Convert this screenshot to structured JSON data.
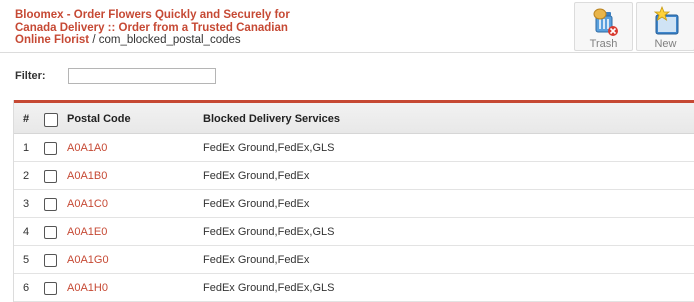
{
  "header": {
    "breadcrumb_link": "Bloomex - Order Flowers Quickly and Securely for Canada Delivery :: Order from a Trusted Canadian Online Florist",
    "breadcrumb_separator": " / ",
    "breadcrumb_current": "com_blocked_postal_codes"
  },
  "toolbar": {
    "trash_label": "Trash",
    "trash_icon": "trash-icon",
    "new_label": "New",
    "new_icon": "new-item-icon"
  },
  "filter": {
    "label": "Filter:",
    "value": "",
    "placeholder": ""
  },
  "grid": {
    "accent_color": "#c64934",
    "columns": {
      "number": "#",
      "postal_code": "Postal Code",
      "services": "Blocked Delivery Services"
    },
    "rows": [
      {
        "num": "1",
        "code": "A0A1A0",
        "services": "FedEx Ground,FedEx,GLS"
      },
      {
        "num": "2",
        "code": "A0A1B0",
        "services": "FedEx Ground,FedEx"
      },
      {
        "num": "3",
        "code": "A0A1C0",
        "services": "FedEx Ground,FedEx"
      },
      {
        "num": "4",
        "code": "A0A1E0",
        "services": "FedEx Ground,FedEx,GLS"
      },
      {
        "num": "5",
        "code": "A0A1G0",
        "services": "FedEx Ground,FedEx"
      },
      {
        "num": "6",
        "code": "A0A1H0",
        "services": "FedEx Ground,FedEx,GLS"
      }
    ]
  }
}
